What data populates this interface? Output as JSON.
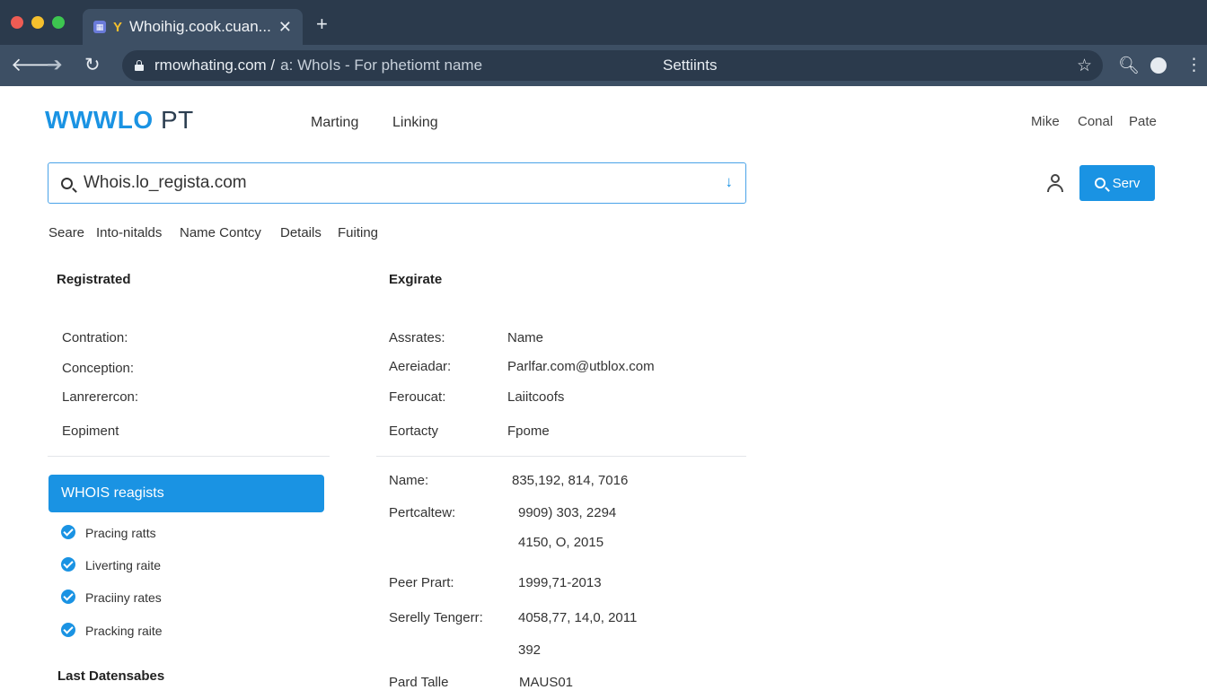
{
  "browser": {
    "tab_title": "Whoihig.cook.cuan...",
    "tab_favicon2": "Y",
    "url_host": "rmowhating.com /",
    "url_path": "a: WhoIs - For phetiomt name",
    "url_settings": "Settiints"
  },
  "header": {
    "logo_main": "WWWLO",
    "logo_suffix": "PT",
    "nav": [
      "Marting",
      "Linking"
    ],
    "user_nav": [
      "Mike",
      "Conal",
      "Pate"
    ]
  },
  "search": {
    "value": "Whois.lo_regista.com",
    "button_label": "Serv"
  },
  "subtabs": [
    "Seare",
    "Into-nitalds",
    "Name Contcy",
    "Details",
    "Fuiting"
  ],
  "left": {
    "heading": "Registrated",
    "fields": [
      "Contration:",
      "Conception:",
      "Lanrerercon:",
      "Eopiment"
    ],
    "action_label": "WHOIS reagists",
    "checks": [
      "Pracing ratts",
      "Liverting raite",
      "Praciiny rates",
      "Pracking raite"
    ],
    "footer_heading": "Last Datensabes"
  },
  "right": {
    "heading": "Exgirate",
    "rows": [
      {
        "label": "Assrates:",
        "value": "Name"
      },
      {
        "label": "Aereiadar:",
        "value": "Parlfar.com@utblox.com"
      },
      {
        "label": "Feroucat:",
        "value": "Laiitcoofs"
      },
      {
        "label": "Eortacty",
        "value": "Fpome"
      }
    ],
    "details": [
      {
        "label": "Name:",
        "value": "835,192, 814, 7016"
      },
      {
        "label": "Pertcaltew:",
        "value": "9909) 303, 2294"
      },
      {
        "label": "",
        "value": "4150, O, 2015"
      },
      {
        "label": "Peer Prart:",
        "value": "1999,71-2013"
      },
      {
        "label": "Serelly Tengerr:",
        "value": "4058,77, 14,0, 2011"
      },
      {
        "label": "",
        "value": "392"
      },
      {
        "label": "Pard Talle",
        "value": "MAUS01"
      }
    ]
  }
}
